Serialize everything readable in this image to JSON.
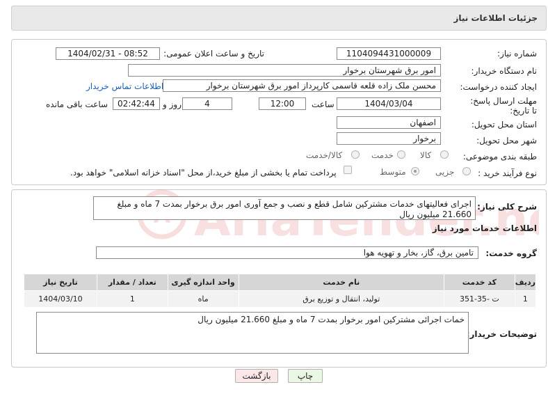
{
  "header": {
    "title": "جزئیات اطلاعات نیاز"
  },
  "form": {
    "need_number_label": "شماره نیاز:",
    "need_number": "1104094431000009",
    "announce_label": "تاریخ و ساعت اعلان عمومی:",
    "announce_value": "1404/02/31 - 08:52",
    "buyer_label": "نام دستگاه خریدار:",
    "buyer_value": "امور برق شهرستان برخوار",
    "requester_label": "ایجاد کننده درخواست:",
    "requester_value": "محسن ملک زاده قلعه قاسمی کارپرداز امور برق شهرستان برخوار",
    "contact_link": "اطلاعات تماس خریدار",
    "deadline_label": "مهلت ارسال پاسخ: تا تاریخ:",
    "deadline_date": "1404/03/04",
    "time_label": "ساعت",
    "deadline_time": "12:00",
    "days_value": "4",
    "days_label": "روز و",
    "remaining_time": "02:42:44",
    "remaining_label": "ساعت باقی مانده",
    "province_label": "استان محل تحویل:",
    "province_value": "اصفهان",
    "city_label": "شهر محل تحویل:",
    "city_value": "برخوار",
    "category_label": "طبقه بندی موضوعی:",
    "category_options": [
      "کالا",
      "خدمت",
      "کالا/خدمت"
    ],
    "process_label": "نوع فرآیند خرید :",
    "process_options": [
      "جزیی",
      "متوسط"
    ],
    "payment_note": "پرداخت تمام یا بخشی از مبلغ خرید،از محل \"اسناد خزانه اسلامی\" خواهد بود."
  },
  "summary": {
    "label": "شرح کلی نیاز:",
    "text": "اجرای فعالیتهای خدمات مشترکین شامل قطع و نصب و جمع آوری امور برق برخوار بمدت 7 ماه و مبلغ 21.660 میلیون ریال"
  },
  "services": {
    "section_title": "اطلاعات خدمات مورد نیاز",
    "group_label": "گروه خدمت:",
    "group_value": "تامین برق، گاز، بخار و تهویه هوا",
    "columns": [
      "ردیف",
      "کد خدمت",
      "نام خدمت",
      "واحد اندازه گیری",
      "تعداد / مقدار",
      "تاریخ نیاز"
    ],
    "rows": [
      {
        "row": "1",
        "code": "ت -35-351",
        "name": "تولید، انتقال و توزیع برق",
        "unit": "ماه",
        "qty": "1",
        "date": "1404/03/10"
      }
    ]
  },
  "buyer_notes": {
    "label": "توضیحات خریدار:",
    "text": "خمات اجرائی مشترکین امور برخوار بمدت 7 ماه و مبلغ 21.660 میلیون ریال"
  },
  "buttons": {
    "print": "چاپ",
    "back": "بازگشت"
  },
  "watermark": {
    "text": "AriaTender.neT"
  },
  "colors": {
    "link": "#1a5fb4",
    "print_bg": "#eaf7e4",
    "back_bg": "#fbe7e7",
    "watermark": "#d64545"
  }
}
